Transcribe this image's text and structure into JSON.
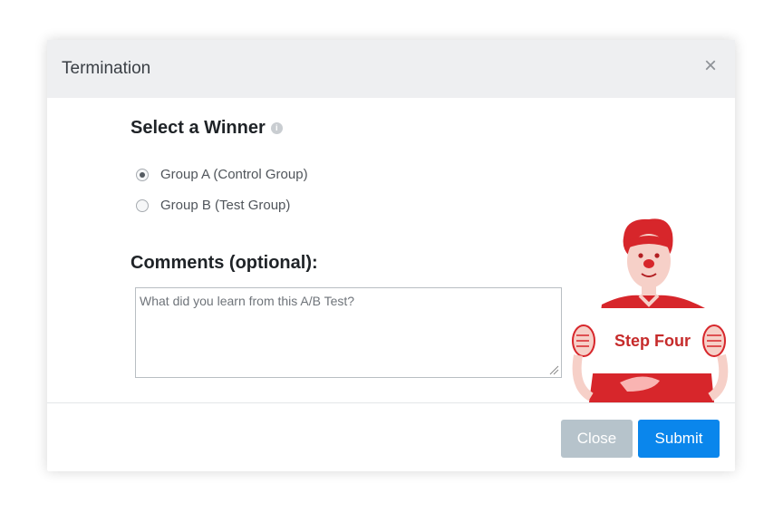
{
  "modal": {
    "title": "Termination",
    "close_icon": "close-icon"
  },
  "winner": {
    "heading": "Select a Winner",
    "help_icon": "info-icon",
    "options": [
      {
        "label": "Group A (Control Group)",
        "selected": true
      },
      {
        "label": "Group B (Test Group)",
        "selected": false
      }
    ]
  },
  "comments": {
    "heading": "Comments (optional):",
    "placeholder": "What did you learn from this A/B Test?",
    "value": ""
  },
  "footer": {
    "close_label": "Close",
    "submit_label": "Submit"
  },
  "mascot": {
    "sign_text": "Step Four",
    "accent_color": "#d7262b"
  }
}
